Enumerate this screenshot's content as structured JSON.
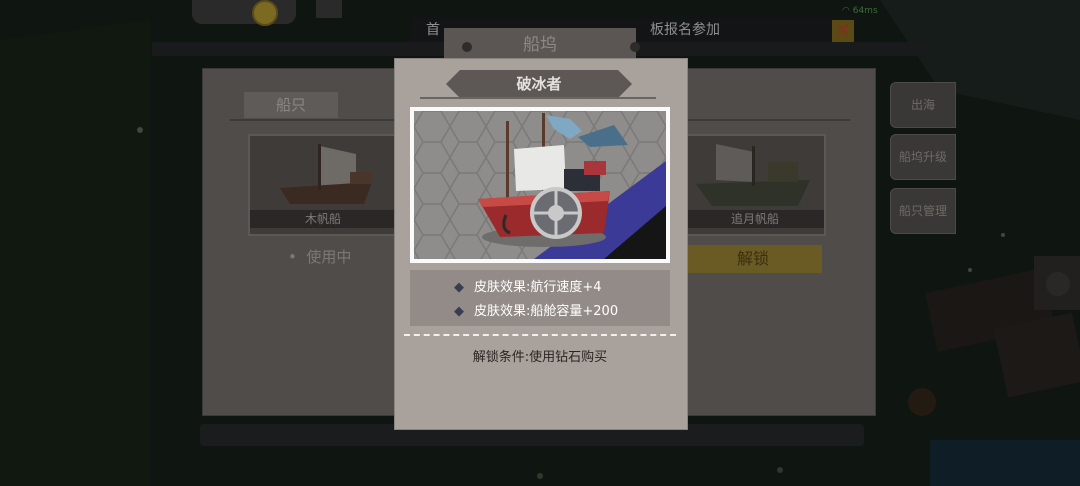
{
  "hud": {
    "ticker_left": "首",
    "ticker_right": "板报名参加",
    "wifi_label": "64ms",
    "close_label": "✕"
  },
  "dock": {
    "title": "船坞",
    "tab_ships": "船只",
    "cards": [
      {
        "name": "木帆船",
        "status": "使用中"
      },
      {
        "name": "追月帆船",
        "action": "解锁"
      }
    ],
    "side_tabs": [
      "出海",
      "船坞升级",
      "船只管理"
    ]
  },
  "popup": {
    "title": "破冰者",
    "effects": [
      "皮肤效果:航行速度+4",
      "皮肤效果:船舱容量+200"
    ],
    "unlock_condition": "解锁条件:使用钻石购买"
  },
  "colors": {
    "popup_bg": "#a9a19c",
    "title_bar": "#5d5856",
    "ship_hull": "#9c2c2c",
    "accent_blue": "#3f3f9a",
    "unlock_button": "#6a5a24"
  }
}
